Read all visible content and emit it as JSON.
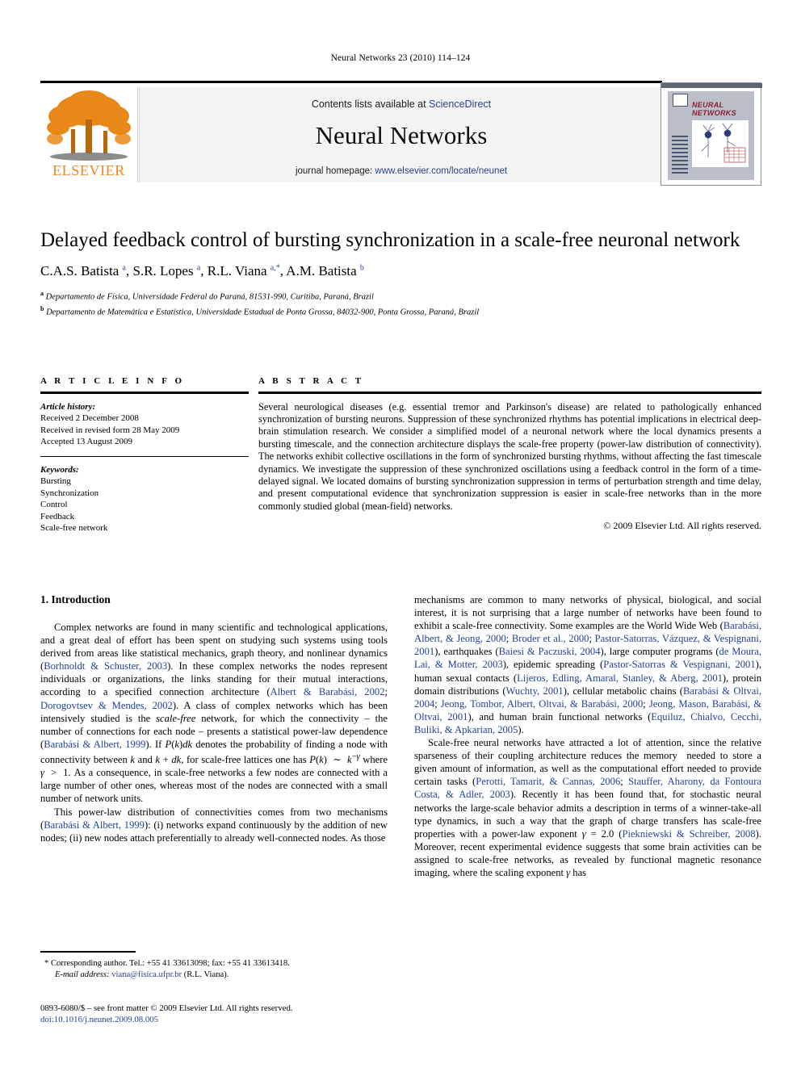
{
  "running_head": "Neural Networks 23 (2010) 114–124",
  "masthead": {
    "contents_prefix": "Contents lists available at ",
    "contents_link": "ScienceDirect",
    "journal_title": "Neural Networks",
    "homepage_label": "journal homepage: ",
    "homepage_url": "www.elsevier.com/locate/neunet",
    "publisher_name": "ELSEVIER",
    "cover_title_line1": "NEURAL",
    "cover_title_line2": "NETWORKS"
  },
  "article": {
    "title": "Delayed feedback control of bursting synchronization in a scale-free neuronal network",
    "authors": "C.A.S. Batista a, S.R. Lopes a, R.L. Viana a,*, A.M. Batista b",
    "affiliation_a": "Departamento de Física, Universidade Federal do Paraná, 81531-990, Curitiba, Paraná, Brazil",
    "affiliation_b": "Departamento de Matemática e Estatística, Universidade Estadual de Ponta Grossa, 84032-900, Ponta Grossa, Paraná, Brazil"
  },
  "info": {
    "heading": "A R T I C L E   I N F O",
    "history_label": "Article history:",
    "history": [
      "Received 2 December 2008",
      "Received in revised form 28 May 2009",
      "Accepted 13 August 2009"
    ],
    "keywords_label": "Keywords:",
    "keywords": [
      "Bursting",
      "Synchronization",
      "Control",
      "Feedback",
      "Scale-free network"
    ]
  },
  "abstract": {
    "heading": "A B S T R A C T",
    "text": "Several neurological diseases (e.g. essential tremor and Parkinson's disease) are related to pathologically enhanced synchronization of bursting neurons. Suppression of these synchronized rhythms has potential implications in electrical deep-brain stimulation research. We consider a simplified model of a neuronal network where the local dynamics presents a bursting timescale, and the connection architecture displays the scale-free property (power-law distribution of connectivity). The networks exhibit collective oscillations in the form of synchronized bursting rhythms, without affecting the fast timescale dynamics. We investigate the suppression of these synchronized oscillations using a feedback control in the form of a time-delayed signal. We located domains of bursting synchronization suppression in terms of perturbation strength and time delay, and present computational evidence that synchronization suppression is easier in scale-free networks than in the more commonly studied global (mean-field) networks.",
    "copyright": "© 2009 Elsevier Ltd. All rights reserved."
  },
  "body": {
    "section_heading": "1. Introduction",
    "left_paragraphs": [
      "Complex networks are found in many scientific and technological applications, and a great deal of effort has been spent on studying such systems using tools derived from areas like statistical mechanics, graph theory, and nonlinear dynamics (Borhnoldt & Schuster, 2003). In these complex networks the nodes represent individuals or organizations, the links standing for their mutual interactions, according to a specified connection architecture (Albert & Barabási, 2002; Dorogovtsev & Mendes, 2002). A class of complex networks which has been intensively studied is the scale-free network, for which the connectivity – the number of connections for each node – presents a statistical power-law dependence (Barabási & Albert, 1999). If P(k)dk denotes the probability of finding a node with connectivity between k and k + dk, for scale-free lattices one has P(k) ~ k−γ where γ > 1. As a consequence, in scale-free networks a few nodes are connected with a large number of other ones, whereas most of the nodes are connected with a small number of network units.",
      "This power-law distribution of connectivities comes from two mechanisms (Barabási & Albert, 1999): (i) networks expand continuously by the addition of new nodes; (ii) new nodes attach preferentially to already well-connected nodes. As those"
    ],
    "right_paragraphs": [
      "mechanisms are common to many networks of physical, biological, and social interest, it is not surprising that a large number of networks have been found to exhibit a scale-free connectivity. Some examples are the World Wide Web (Barabási, Albert, & Jeong, 2000; Broder et al., 2000; Pastor-Satorras, Vázquez, & Vespignani, 2001), earthquakes (Baiesi & Paczuski, 2004), large computer programs (de Moura, Lai, & Motter, 2003), epidemic spreading (Pastor-Satorras & Vespignani, 2001), human sexual contacts (Lijeros, Edling, Amaral, Stanley, & Aberg, 2001), protein domain distributions (Wuchty, 2001), cellular metabolic chains (Barabási & Oltvai, 2004; Jeong, Tombor, Albert, Oltvai, & Barabási, 2000; Jeong, Mason, Barabási, & Oltvai, 2001), and human brain functional networks (Equiluz, Chialvo, Cecchi, Buliki, & Apkarian, 2005).",
      "Scale-free neural networks have attracted a lot of attention, since the relative sparseness of their coupling architecture reduces the memory  needed to store a given amount of information, as well as the computational effort needed to provide certain tasks (Perotti, Tamarit, & Cannas, 2006; Stauffer, Aharony, da Fontoura Costa, & Adler, 2003). Recently it has been found that, for stochastic neural networks the large-scale behavior admits a description in terms of a winner-take-all type dynamics, in such a way that the graph of charge transfers has scale-free properties with a power-law exponent γ = 2.0 (Piekniewski & Schreiber, 2008). Moreover, recent experimental evidence suggests that some brain activities can be assigned to scale-free networks, as revealed by functional magnetic resonance imaging, where the scaling exponent γ has"
    ]
  },
  "footnote": {
    "line1": "* Corresponding author. Tel.: +55 41 33613098; fax: +55 41 33613418.",
    "email_label": "E-mail address:",
    "email": "viana@fisica.ufpr.br",
    "email_suffix": "(R.L. Viana)."
  },
  "footer": {
    "issn_line": "0893-6080/$ – see front matter © 2009 Elsevier Ltd. All rights reserved.",
    "doi_line": "doi:10.1016/j.neunet.2009.08.005"
  },
  "colors": {
    "link": "#21409a",
    "elsevier_orange": "#F08521",
    "cover_gray": "#b9bec9",
    "cover_red": "#8a2030"
  }
}
